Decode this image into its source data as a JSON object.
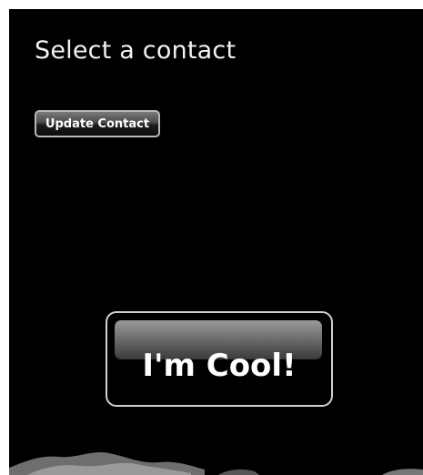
{
  "screen": {
    "title": "Select a contact"
  },
  "buttons": {
    "update_contact_label": "Update Contact",
    "cool_label": "I'm Cool!"
  },
  "colors": {
    "background": "#000000",
    "text": "#ffffff",
    "button_border": "#c0c0c0"
  }
}
